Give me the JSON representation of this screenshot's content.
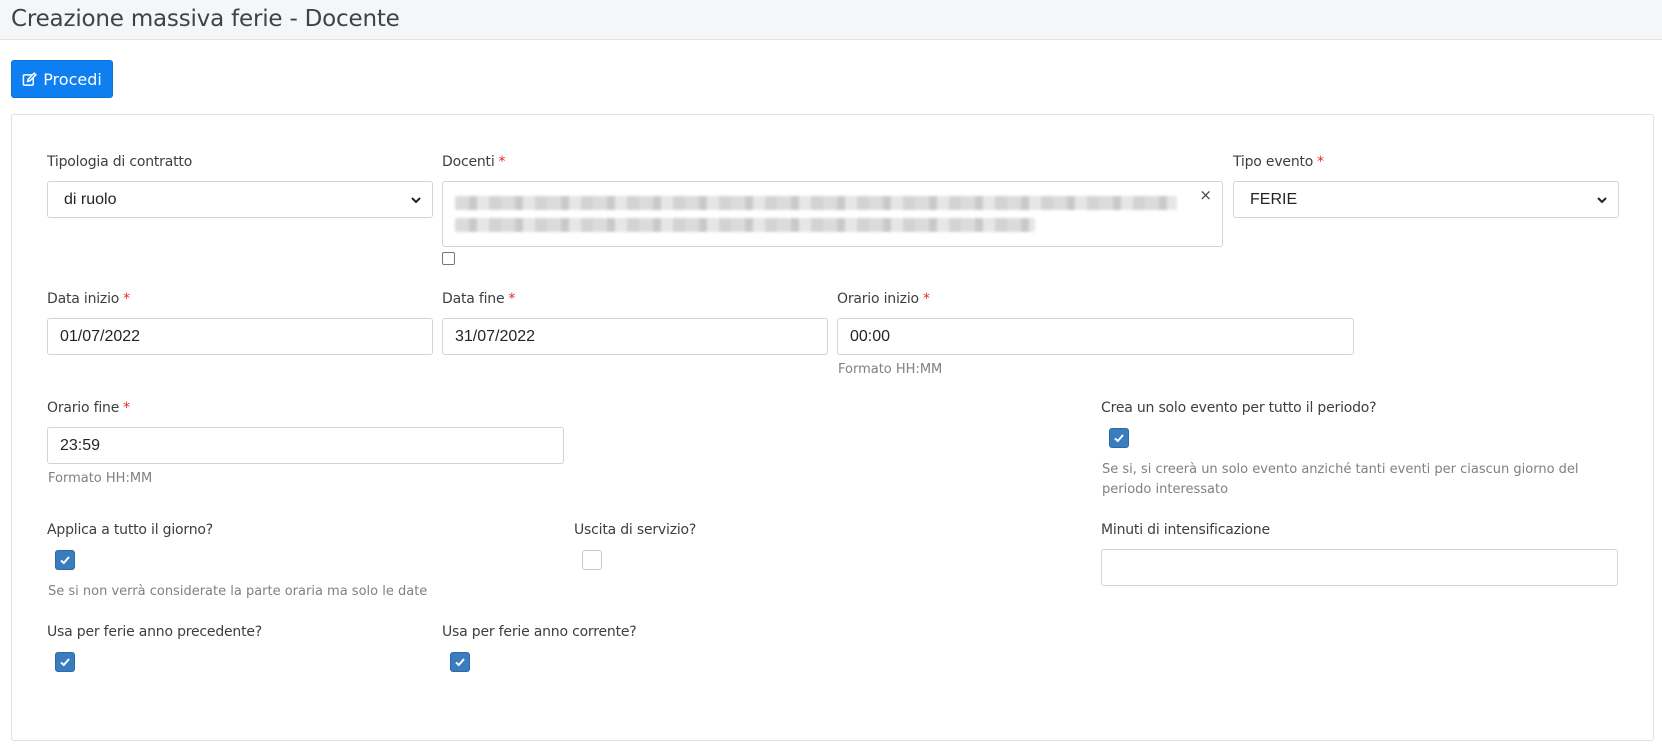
{
  "header": {
    "title": "Creazione massiva ferie - Docente"
  },
  "toolbar": {
    "procedi_label": "Procedi"
  },
  "form": {
    "tipologia_contratto": {
      "label": "Tipologia di contratto",
      "value": "di ruolo"
    },
    "docenti": {
      "label": "Docenti",
      "required": "*",
      "clear": "×"
    },
    "tipo_evento": {
      "label": "Tipo evento",
      "required": "*",
      "value": "FERIE"
    },
    "data_inizio": {
      "label": "Data inizio",
      "required": "*",
      "value": "01/07/2022"
    },
    "data_fine": {
      "label": "Data fine",
      "required": "*",
      "value": "31/07/2022"
    },
    "orario_inizio": {
      "label": "Orario inizio",
      "required": "*",
      "value": "00:00",
      "help": "Formato HH:MM"
    },
    "orario_fine": {
      "label": "Orario fine",
      "required": "*",
      "value": "23:59",
      "help": "Formato HH:MM"
    },
    "solo_evento": {
      "label": "Crea un solo evento per tutto il periodo?",
      "checked": true,
      "help": "Se si, si creerà un solo evento anziché tanti eventi per ciascun giorno del periodo interessato"
    },
    "tutto_giorno": {
      "label": "Applica a tutto il giorno?",
      "checked": true,
      "help": "Se si non verrà considerate la parte oraria ma solo le date"
    },
    "uscita_servizio": {
      "label": "Uscita di servizio?",
      "checked": false
    },
    "minuti_intensificazione": {
      "label": "Minuti di intensificazione",
      "value": ""
    },
    "ferie_precedente": {
      "label": "Usa per ferie anno precedente?",
      "checked": true
    },
    "ferie_corrente": {
      "label": "Usa per ferie anno corrente?",
      "checked": true
    }
  },
  "colors": {
    "primary": "#0d7ff0",
    "checkbox": "#3a7dbf",
    "required": "#e02b2b"
  }
}
